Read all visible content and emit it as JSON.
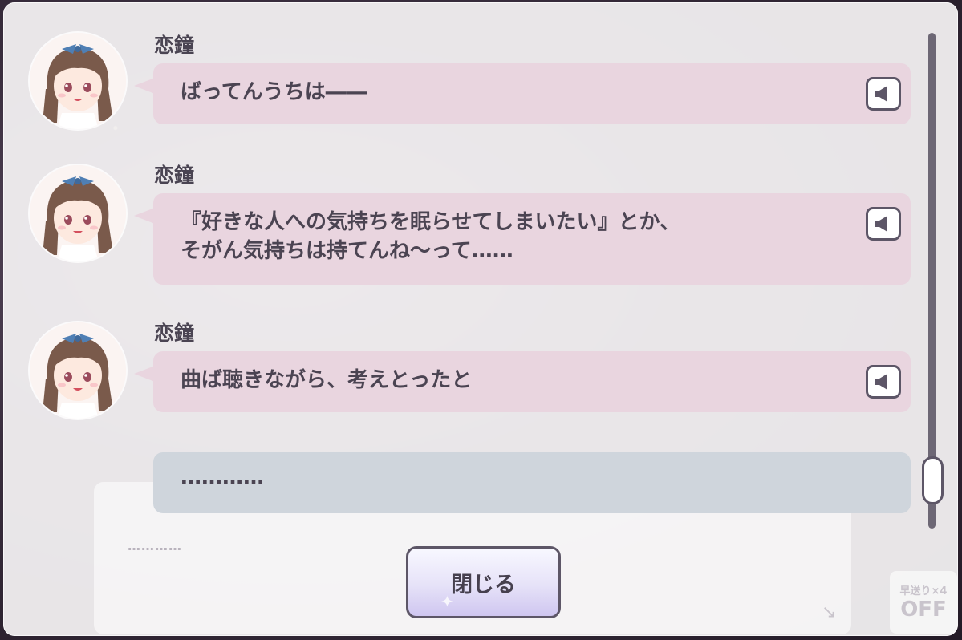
{
  "log": {
    "entries": [
      {
        "speaker": "恋鐘",
        "text": "ばってんうちは――",
        "avatar_icon": "koito-avatar-icon",
        "voice_icon": "speaker-icon"
      },
      {
        "speaker": "恋鐘",
        "text": "『好きな人への気持ちを眠らせてしまいたい』とか、\nそがん気持ちは持てんね～って……",
        "avatar_icon": "koito-avatar-icon",
        "voice_icon": "speaker-icon"
      },
      {
        "speaker": "恋鐘",
        "text": "曲ば聴きながら、考えとったと",
        "avatar_icon": "koito-avatar-icon",
        "voice_icon": "speaker-icon"
      }
    ],
    "narration": "…………"
  },
  "buttons": {
    "close_label": "閉じる"
  },
  "background_ui": {
    "ghost_text": "…………",
    "speed_label": "早送り×4",
    "speed_state": "OFF"
  },
  "colors": {
    "bubble": "#e9d5df",
    "narration_bubble": "#cfd5dc",
    "outline": "#5d5667",
    "text": "#4b4452"
  }
}
